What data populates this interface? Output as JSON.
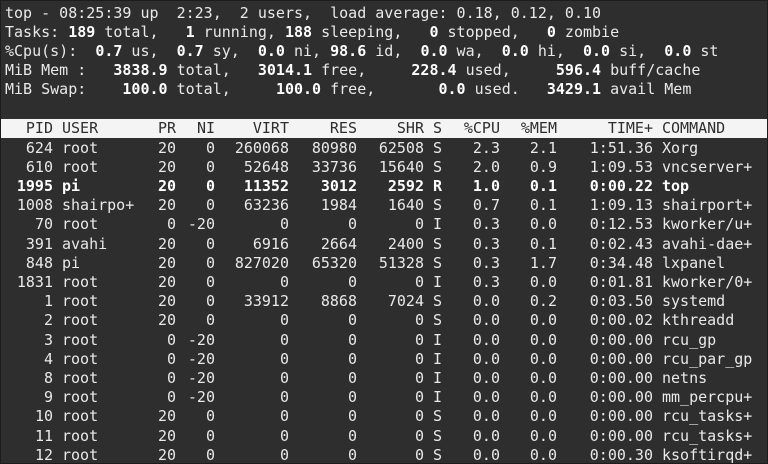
{
  "summary": {
    "top_line": {
      "prefix": "top - 08:25:39 up  2:23,  2 users,  load average: 0.18, 0.12, 0.10"
    },
    "tasks": {
      "label": "Tasks: ",
      "total": "189",
      "total_label": " total,   ",
      "running": "1",
      "running_label": " running, ",
      "sleeping": "188",
      "sleeping_label": " sleeping,   ",
      "stopped": "0",
      "stopped_label": " stopped,   ",
      "zombie": "0",
      "zombie_label": " zombie"
    },
    "cpu": {
      "label": "%Cpu(s):  ",
      "us": "0.7",
      "us_label": " us,  ",
      "sy": "0.7",
      "sy_label": " sy,  ",
      "ni": "0.0",
      "ni_label": " ni, ",
      "id": "98.6",
      "id_label": " id,  ",
      "wa": "0.0",
      "wa_label": " wa,  ",
      "hi": "0.0",
      "hi_label": " hi,  ",
      "si": "0.0",
      "si_label": " si,  ",
      "st": "0.0",
      "st_label": " st"
    },
    "mem": {
      "label": "MiB Mem :   ",
      "total": "3838.9",
      "total_label": " total,   ",
      "free": "3014.1",
      "free_label": " free,     ",
      "used": "228.4",
      "used_label": " used,     ",
      "buff": "596.4",
      "buff_label": " buff/cache"
    },
    "swap": {
      "label": "MiB Swap:    ",
      "total": "100.0",
      "total_label": " total,     ",
      "free": "100.0",
      "free_label": " free,       ",
      "used": "0.0",
      "used_label": " used.   ",
      "avail": "3429.1",
      "avail_label": " avail Mem"
    }
  },
  "columns": [
    {
      "key": "pid",
      "label": "PID"
    },
    {
      "key": "user",
      "label": "USER"
    },
    {
      "key": "pr",
      "label": "PR"
    },
    {
      "key": "ni",
      "label": "NI"
    },
    {
      "key": "virt",
      "label": "VIRT"
    },
    {
      "key": "res",
      "label": "RES"
    },
    {
      "key": "shr",
      "label": "SHR"
    },
    {
      "key": "s",
      "label": "S"
    },
    {
      "key": "cpu",
      "label": "%CPU"
    },
    {
      "key": "mem",
      "label": "%MEM"
    },
    {
      "key": "time",
      "label": "TIME+"
    },
    {
      "key": "command",
      "label": "COMMAND"
    }
  ],
  "processes": [
    {
      "pid": "624",
      "user": "root",
      "pr": "20",
      "ni": "0",
      "virt": "260068",
      "res": "80980",
      "shr": "62508",
      "s": "S",
      "cpu": "2.3",
      "mem": "2.1",
      "time": "1:51.36",
      "command": "Xorg",
      "highlight": false
    },
    {
      "pid": "610",
      "user": "root",
      "pr": "20",
      "ni": "0",
      "virt": "52648",
      "res": "33736",
      "shr": "15640",
      "s": "S",
      "cpu": "2.0",
      "mem": "0.9",
      "time": "1:09.53",
      "command": "vncserver+",
      "highlight": false
    },
    {
      "pid": "1995",
      "user": "pi",
      "pr": "20",
      "ni": "0",
      "virt": "11352",
      "res": "3012",
      "shr": "2592",
      "s": "R",
      "cpu": "1.0",
      "mem": "0.1",
      "time": "0:00.22",
      "command": "top",
      "highlight": true
    },
    {
      "pid": "1008",
      "user": "shairpo+",
      "pr": "20",
      "ni": "0",
      "virt": "63236",
      "res": "1984",
      "shr": "1640",
      "s": "S",
      "cpu": "0.7",
      "mem": "0.1",
      "time": "1:09.13",
      "command": "shairport+",
      "highlight": false
    },
    {
      "pid": "70",
      "user": "root",
      "pr": "0",
      "ni": "-20",
      "virt": "0",
      "res": "0",
      "shr": "0",
      "s": "I",
      "cpu": "0.3",
      "mem": "0.0",
      "time": "0:12.53",
      "command": "kworker/u+",
      "highlight": false
    },
    {
      "pid": "391",
      "user": "avahi",
      "pr": "20",
      "ni": "0",
      "virt": "6916",
      "res": "2664",
      "shr": "2400",
      "s": "S",
      "cpu": "0.3",
      "mem": "0.1",
      "time": "0:02.43",
      "command": "avahi-dae+",
      "highlight": false
    },
    {
      "pid": "848",
      "user": "pi",
      "pr": "20",
      "ni": "0",
      "virt": "827020",
      "res": "65320",
      "shr": "51328",
      "s": "S",
      "cpu": "0.3",
      "mem": "1.7",
      "time": "0:34.48",
      "command": "lxpanel",
      "highlight": false
    },
    {
      "pid": "1831",
      "user": "root",
      "pr": "20",
      "ni": "0",
      "virt": "0",
      "res": "0",
      "shr": "0",
      "s": "I",
      "cpu": "0.3",
      "mem": "0.0",
      "time": "0:01.81",
      "command": "kworker/0+",
      "highlight": false
    },
    {
      "pid": "1",
      "user": "root",
      "pr": "20",
      "ni": "0",
      "virt": "33912",
      "res": "8868",
      "shr": "7024",
      "s": "S",
      "cpu": "0.0",
      "mem": "0.2",
      "time": "0:03.50",
      "command": "systemd",
      "highlight": false
    },
    {
      "pid": "2",
      "user": "root",
      "pr": "20",
      "ni": "0",
      "virt": "0",
      "res": "0",
      "shr": "0",
      "s": "S",
      "cpu": "0.0",
      "mem": "0.0",
      "time": "0:00.02",
      "command": "kthreadd",
      "highlight": false
    },
    {
      "pid": "3",
      "user": "root",
      "pr": "0",
      "ni": "-20",
      "virt": "0",
      "res": "0",
      "shr": "0",
      "s": "I",
      "cpu": "0.0",
      "mem": "0.0",
      "time": "0:00.00",
      "command": "rcu_gp",
      "highlight": false
    },
    {
      "pid": "4",
      "user": "root",
      "pr": "0",
      "ni": "-20",
      "virt": "0",
      "res": "0",
      "shr": "0",
      "s": "I",
      "cpu": "0.0",
      "mem": "0.0",
      "time": "0:00.00",
      "command": "rcu_par_gp",
      "highlight": false
    },
    {
      "pid": "8",
      "user": "root",
      "pr": "0",
      "ni": "-20",
      "virt": "0",
      "res": "0",
      "shr": "0",
      "s": "I",
      "cpu": "0.0",
      "mem": "0.0",
      "time": "0:00.00",
      "command": "netns",
      "highlight": false
    },
    {
      "pid": "9",
      "user": "root",
      "pr": "0",
      "ni": "-20",
      "virt": "0",
      "res": "0",
      "shr": "0",
      "s": "I",
      "cpu": "0.0",
      "mem": "0.0",
      "time": "0:00.00",
      "command": "mm_percpu+",
      "highlight": false
    },
    {
      "pid": "10",
      "user": "root",
      "pr": "20",
      "ni": "0",
      "virt": "0",
      "res": "0",
      "shr": "0",
      "s": "S",
      "cpu": "0.0",
      "mem": "0.0",
      "time": "0:00.00",
      "command": "rcu_tasks+",
      "highlight": false
    },
    {
      "pid": "11",
      "user": "root",
      "pr": "20",
      "ni": "0",
      "virt": "0",
      "res": "0",
      "shr": "0",
      "s": "S",
      "cpu": "0.0",
      "mem": "0.0",
      "time": "0:00.00",
      "command": "rcu_tasks+",
      "highlight": false
    },
    {
      "pid": "12",
      "user": "root",
      "pr": "20",
      "ni": "0",
      "virt": "0",
      "res": "0",
      "shr": "0",
      "s": "S",
      "cpu": "0.0",
      "mem": "0.0",
      "time": "0:00.30",
      "command": "ksoftirqd+",
      "highlight": false
    }
  ],
  "colors": {
    "background": "#2e2e2e",
    "foreground": "#e9e9e9",
    "header_bg": "#f4f4f4",
    "header_fg": "#2e2e2e"
  }
}
